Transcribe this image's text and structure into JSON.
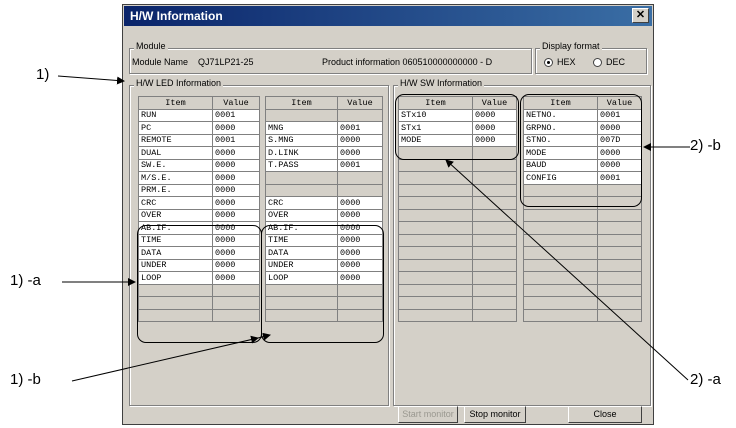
{
  "window": {
    "title": "H/W Information"
  },
  "module": {
    "group_label": "Module",
    "name_label": "Module Name",
    "name_value": "QJ71LP21-25",
    "product_info": "Product information 060510000000000 - D"
  },
  "display_format": {
    "label": "Display format",
    "hex": "HEX",
    "dec": "DEC",
    "selected": "HEX"
  },
  "led": {
    "group_label": "H/W LED Information",
    "headers": [
      "Item",
      "Value"
    ],
    "left": [
      [
        "RUN",
        "0001"
      ],
      [
        "PC",
        "0000"
      ],
      [
        "REMOTE",
        "0001"
      ],
      [
        "DUAL",
        "0000"
      ],
      [
        "SW.E.",
        "0000"
      ],
      [
        "M/S.E.",
        "0000"
      ],
      [
        "PRM.E.",
        "0000"
      ],
      [
        "CRC",
        "0000"
      ],
      [
        "OVER",
        "0000"
      ],
      [
        "AB.IF.",
        "0000"
      ],
      [
        "TIME",
        "0000"
      ],
      [
        "DATA",
        "0000"
      ],
      [
        "UNDER",
        "0000"
      ],
      [
        "LOOP",
        "0000"
      ]
    ],
    "right": [
      [
        "",
        ""
      ],
      [
        "MNG",
        "0001"
      ],
      [
        "S.MNG",
        "0000"
      ],
      [
        "D.LINK",
        "0000"
      ],
      [
        "T.PASS",
        "0001"
      ],
      [
        "",
        ""
      ],
      [
        "",
        ""
      ],
      [
        "CRC",
        "0000"
      ],
      [
        "OVER",
        "0000"
      ],
      [
        "AB.IF.",
        "0000"
      ],
      [
        "TIME",
        "0000"
      ],
      [
        "DATA",
        "0000"
      ],
      [
        "UNDER",
        "0000"
      ],
      [
        "LOOP",
        "0000"
      ]
    ]
  },
  "sw": {
    "group_label": "H/W SW Information",
    "headers": [
      "Item",
      "Value"
    ],
    "left": [
      [
        "STx10",
        "0000"
      ],
      [
        "STx1",
        "0000"
      ],
      [
        "MODE",
        "0000"
      ]
    ],
    "right": [
      [
        "NETNO.",
        "0001"
      ],
      [
        "GRPNO.",
        "0000"
      ],
      [
        "STNO.",
        "007D"
      ],
      [
        "MODE",
        "0000"
      ],
      [
        "BAUD",
        "0000"
      ],
      [
        "CONFIG",
        "0001"
      ]
    ]
  },
  "buttons": {
    "start": "Start monitor",
    "stop": "Stop monitor",
    "close": "Close"
  },
  "annotations": {
    "a1": "1)",
    "a1a": "1) -a",
    "a1b": "1) -b",
    "a2a": "2) -a",
    "a2b": "2) -b"
  }
}
